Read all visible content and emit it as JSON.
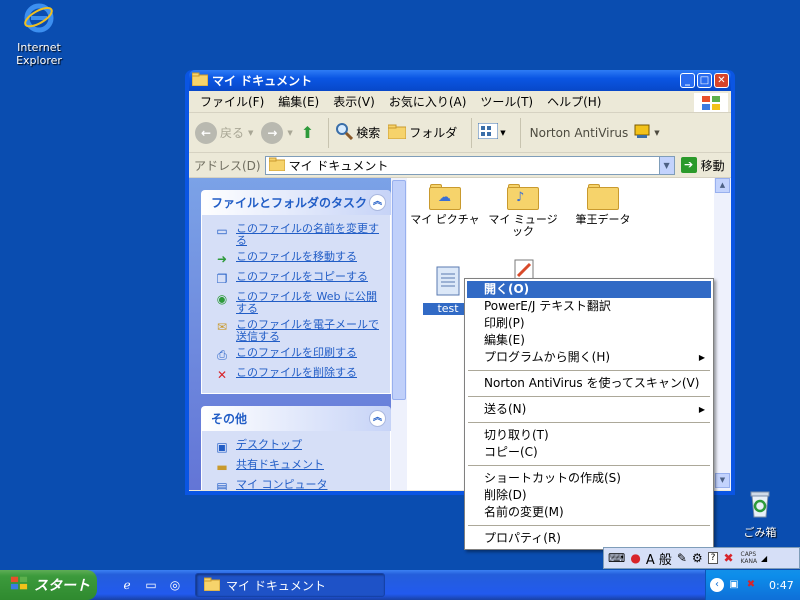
{
  "desktop": {
    "icons": [
      {
        "label": "Internet\nExplorer",
        "icon": "internet-explorer-icon"
      },
      {
        "label": "ごみ箱",
        "icon": "recycle-bin-icon"
      }
    ]
  },
  "window": {
    "title": "マイ ドキュメント",
    "menu": [
      "ファイル(F)",
      "編集(E)",
      "表示(V)",
      "お気に入り(A)",
      "ツール(T)",
      "ヘルプ(H)"
    ],
    "toolbar": {
      "back": "戻る",
      "search": "検索",
      "folders": "フォルダ",
      "norton": "Norton AntiVirus"
    },
    "address": {
      "label": "アドレス(D)",
      "value": "マイ ドキュメント",
      "go": "移動"
    }
  },
  "taskpane": {
    "file_tasks": {
      "title": "ファイルとフォルダのタスク",
      "items": [
        {
          "label": "このファイルの名前を変更する",
          "icon": "rename-icon"
        },
        {
          "label": "このファイルを移動する",
          "icon": "move-icon"
        },
        {
          "label": "このファイルをコピーする",
          "icon": "copy-icon"
        },
        {
          "label": "このファイルを Web に公開する",
          "icon": "web-publish-icon"
        },
        {
          "label": "このファイルを電子メールで送信する",
          "icon": "email-icon"
        },
        {
          "label": "このファイルを印刷する",
          "icon": "print-icon"
        },
        {
          "label": "このファイルを削除する",
          "icon": "delete-icon"
        }
      ]
    },
    "other": {
      "title": "その他",
      "items": [
        {
          "label": "デスクトップ",
          "icon": "desktop-icon"
        },
        {
          "label": "共有ドキュメント",
          "icon": "folder-icon"
        },
        {
          "label": "マイ コンピュータ",
          "icon": "computer-icon"
        }
      ]
    }
  },
  "files": [
    {
      "name": "マイ ピクチャ",
      "icon": "pictures-folder-icon"
    },
    {
      "name": "マイ ミュージック",
      "icon": "music-folder-icon"
    },
    {
      "name": "筆王データ",
      "icon": "folder-icon"
    },
    {
      "name": "test",
      "icon": "text-file-icon"
    },
    {
      "name": "",
      "icon": "document-file-icon"
    }
  ],
  "context_menu": [
    {
      "type": "item",
      "label": "開く(O)",
      "highlight": true
    },
    {
      "type": "item",
      "label": "PowerE/J テキスト翻訳"
    },
    {
      "type": "item",
      "label": "印刷(P)"
    },
    {
      "type": "item",
      "label": "編集(E)"
    },
    {
      "type": "item",
      "label": "プログラムから開く(H)",
      "submenu": true
    },
    {
      "type": "sep"
    },
    {
      "type": "item",
      "label": "Norton AntiVirus を使ってスキャン(V)"
    },
    {
      "type": "sep"
    },
    {
      "type": "item",
      "label": "送る(N)",
      "submenu": true
    },
    {
      "type": "sep"
    },
    {
      "type": "item",
      "label": "切り取り(T)"
    },
    {
      "type": "item",
      "label": "コピー(C)"
    },
    {
      "type": "sep"
    },
    {
      "type": "item",
      "label": "ショートカットの作成(S)"
    },
    {
      "type": "item",
      "label": "削除(D)"
    },
    {
      "type": "item",
      "label": "名前の変更(M)"
    },
    {
      "type": "sep"
    },
    {
      "type": "item",
      "label": "プロパティ(R)"
    }
  ],
  "langbar": {
    "mode": "A 般",
    "caps": "CAPS",
    "kana": "KANA"
  },
  "taskbar": {
    "start": "スタート",
    "active_task": "マイ ドキュメント",
    "clock": "0:47"
  }
}
